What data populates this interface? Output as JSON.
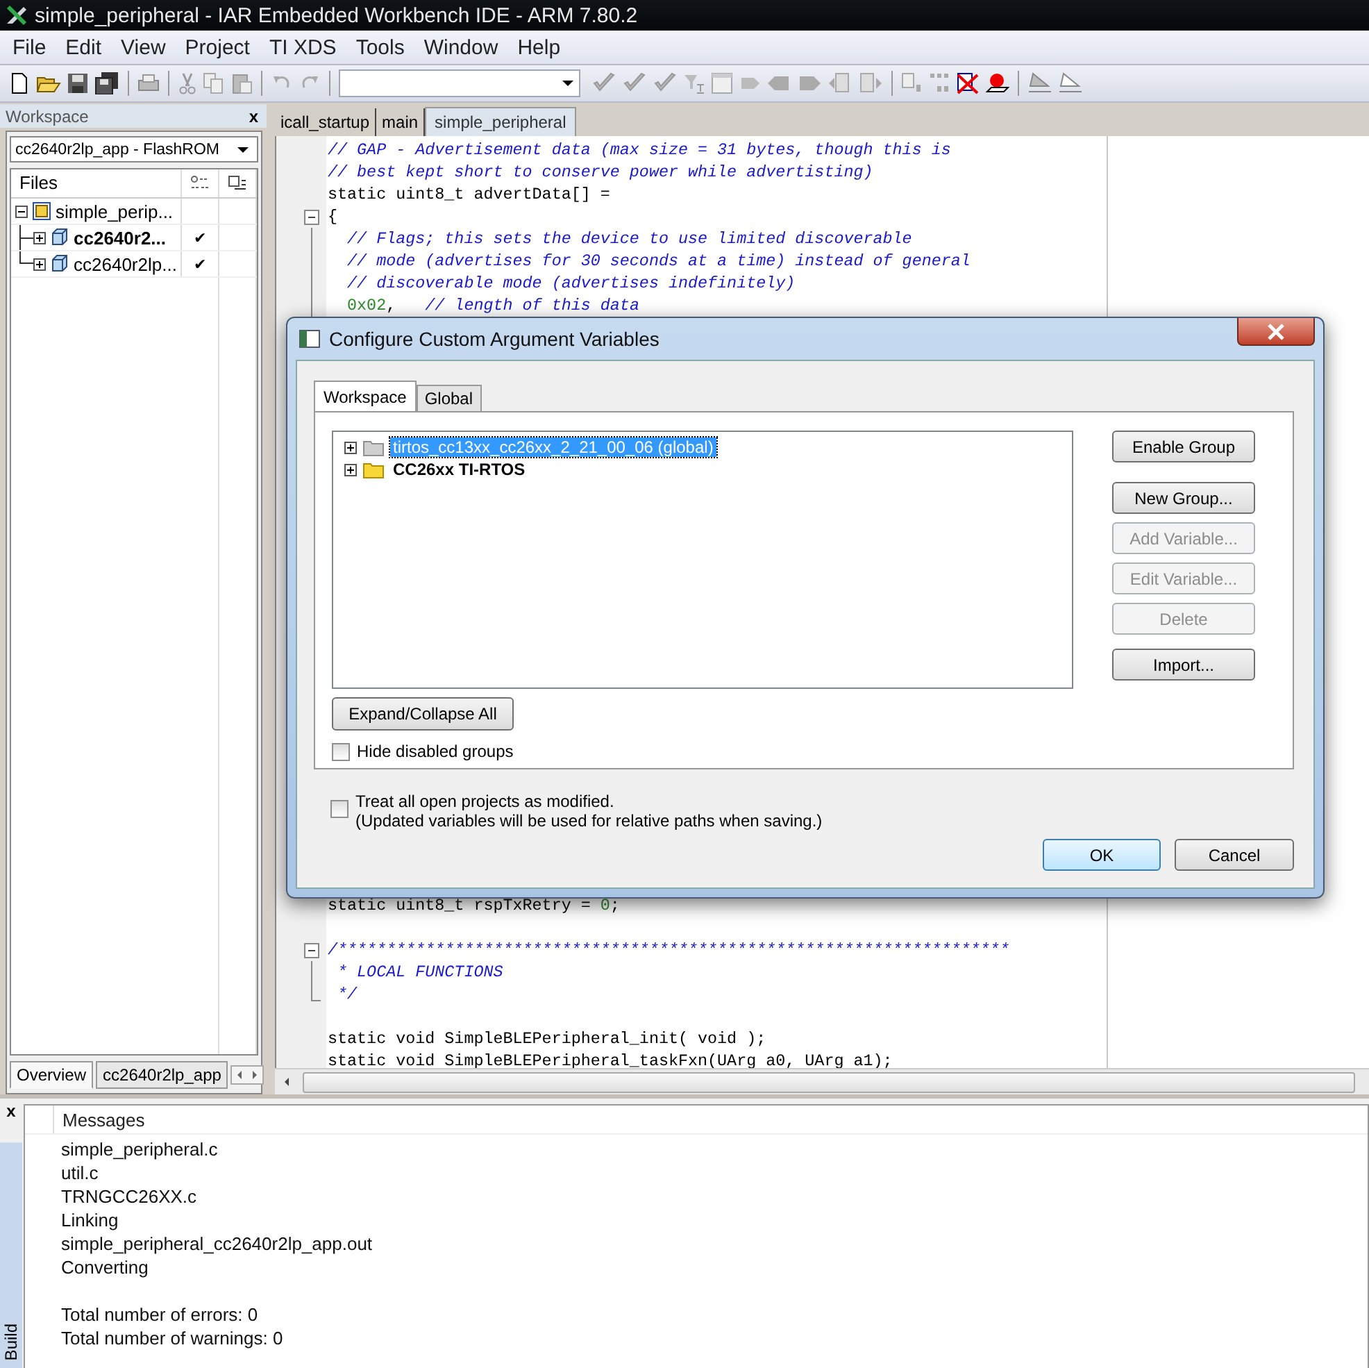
{
  "window": {
    "title": "simple_peripheral - IAR Embedded Workbench IDE - ARM 7.80.2"
  },
  "menu": [
    "File",
    "Edit",
    "View",
    "Project",
    "TI XDS",
    "Tools",
    "Window",
    "Help"
  ],
  "workspace": {
    "title": "Workspace",
    "close": "x",
    "configuration": "cc2640r2lp_app - FlashROM",
    "files_header": "Files",
    "tree": [
      {
        "label": "simple_perip...",
        "expanded": true,
        "children": [
          {
            "label": "cc2640r2...",
            "active": true,
            "expanded": false,
            "check": "✔"
          },
          {
            "label": "cc2640r2lp...",
            "active": false,
            "expanded": false,
            "check": "✔"
          }
        ]
      }
    ],
    "tabs": [
      {
        "label": "Overview",
        "selected": true
      },
      {
        "label": "cc2640r2lp_app",
        "selected": false
      }
    ]
  },
  "editor": {
    "tabs": [
      {
        "label": "icall_startup",
        "selected": false
      },
      {
        "label": "main",
        "selected": false
      },
      {
        "label": "simple_peripheral",
        "selected": true
      }
    ],
    "lines_top": [
      {
        "segments": [
          {
            "kind": "comment",
            "text": "// GAP - Advertisement data (max size = 31 bytes, though this is"
          }
        ]
      },
      {
        "segments": [
          {
            "kind": "comment",
            "text": "// best kept short to conserve power while advertisting)"
          }
        ]
      },
      {
        "segments": [
          {
            "kind": "code",
            "text": "static uint8_t advertData[] ="
          }
        ]
      },
      {
        "fold_start": true,
        "segments": [
          {
            "kind": "code",
            "text": "{"
          }
        ]
      },
      {
        "in_fold": true,
        "segments": [
          {
            "kind": "comment",
            "text": "  // Flags; this sets the device to use limited discoverable"
          }
        ]
      },
      {
        "in_fold": true,
        "segments": [
          {
            "kind": "comment",
            "text": "  // mode (advertises for 30 seconds at a time) instead of general"
          }
        ]
      },
      {
        "in_fold": true,
        "segments": [
          {
            "kind": "comment",
            "text": "  // discoverable mode (advertises indefinitely)"
          }
        ]
      },
      {
        "in_fold": true,
        "segments": [
          {
            "kind": "number",
            "text": "  0x02"
          },
          {
            "kind": "code",
            "text": ",   "
          },
          {
            "kind": "comment",
            "text": "// length of this data"
          }
        ]
      }
    ],
    "lines_bottom": [
      {
        "segments": [
          {
            "kind": "code",
            "text": "static uint8_t rspTxRetry = "
          },
          {
            "kind": "number",
            "text": "0"
          },
          {
            "kind": "code",
            "text": ";"
          }
        ]
      },
      {
        "blank_before": true,
        "fold_start": true,
        "segments": [
          {
            "kind": "comment",
            "text": "/*********************************************************************"
          }
        ]
      },
      {
        "in_fold": true,
        "segments": [
          {
            "kind": "comment",
            "text": " * LOCAL FUNCTIONS"
          }
        ]
      },
      {
        "fold_end": true,
        "segments": [
          {
            "kind": "comment",
            "text": " */"
          }
        ]
      },
      {
        "blank_before": true,
        "segments": [
          {
            "kind": "code",
            "text": "static void SimpleBLEPeripheral_init( void );"
          }
        ]
      },
      {
        "segments": [
          {
            "kind": "code",
            "text": "static void SimpleBLEPeripheral_taskFxn(UArg a0, UArg a1);"
          }
        ]
      }
    ]
  },
  "dialog": {
    "title": "Configure Custom Argument Variables",
    "tabs": [
      {
        "label": "Workspace",
        "selected": true
      },
      {
        "label": "Global",
        "selected": false
      }
    ],
    "groups": [
      {
        "label": "tirtos_cc13xx_cc26xx_2_21_00_06 (global)",
        "enabled": false,
        "selected": true,
        "expanded": false
      },
      {
        "label": "CC26xx TI-RTOS",
        "enabled": true,
        "selected": false,
        "expanded": false
      }
    ],
    "buttons": [
      {
        "label": "Enable Group",
        "disabled": false
      },
      {
        "label": "New Group...",
        "disabled": false
      },
      {
        "label": "Add Variable...",
        "disabled": true
      },
      {
        "label": "Edit Variable...",
        "disabled": true
      },
      {
        "label": "Delete",
        "disabled": true
      },
      {
        "label": "Import...",
        "disabled": false
      }
    ],
    "expand_collapse": "Expand/Collapse All",
    "hide_disabled": {
      "label": "Hide disabled groups",
      "checked": false
    },
    "treat_all": {
      "label": "Treat all open projects as modified.",
      "checked": false
    },
    "note": "(Updated variables will be used for relative paths when saving.)",
    "ok": "OK",
    "cancel": "Cancel"
  },
  "build": {
    "tab": "Build",
    "close": "x",
    "header": "Messages",
    "messages": [
      "simple_peripheral.c",
      "util.c",
      "TRNGCC26XX.c",
      "Linking",
      "simple_peripheral_cc2640r2lp_app.out",
      "Converting"
    ],
    "totals": [
      "Total number of errors: 0",
      "Total number of warnings: 0"
    ]
  }
}
